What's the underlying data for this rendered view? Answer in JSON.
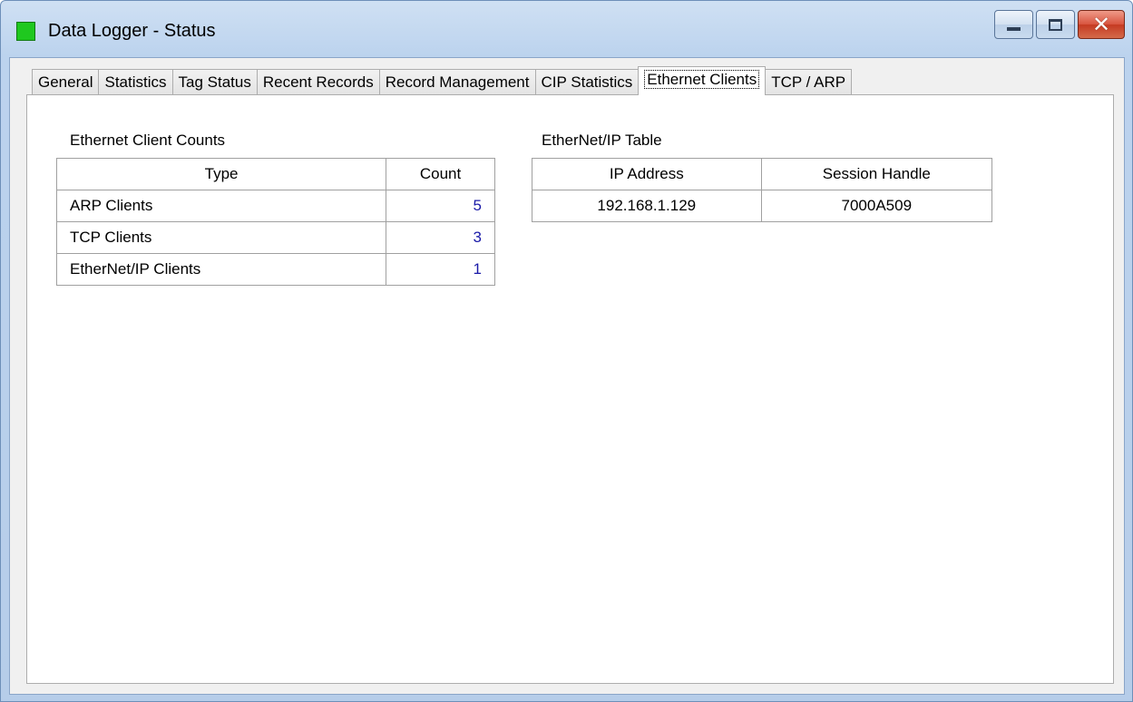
{
  "window": {
    "title": "Data Logger - Status",
    "buttons": {
      "minimize": "minimize",
      "maximize": "maximize",
      "close": "close"
    }
  },
  "tabs": [
    {
      "label": "General"
    },
    {
      "label": "Statistics"
    },
    {
      "label": "Tag Status"
    },
    {
      "label": "Recent Records"
    },
    {
      "label": "Record Management"
    },
    {
      "label": "CIP Statistics"
    },
    {
      "label": "Ethernet Clients",
      "active": true
    },
    {
      "label": "TCP / ARP"
    }
  ],
  "client_counts": {
    "title": "Ethernet Client Counts",
    "headers": {
      "type": "Type",
      "count": "Count"
    },
    "rows": [
      {
        "type": "ARP Clients",
        "count": "5"
      },
      {
        "type": "TCP Clients",
        "count": "3"
      },
      {
        "type": "EtherNet/IP Clients",
        "count": "1"
      }
    ]
  },
  "enip_table": {
    "title": "EtherNet/IP Table",
    "headers": {
      "ip": "IP Address",
      "session": "Session Handle"
    },
    "rows": [
      {
        "ip": "192.168.1.129",
        "session": "7000A509"
      }
    ]
  },
  "colors": {
    "status_icon": "#1fc81f",
    "count_text": "#1a1aa8",
    "titlebar": "#bcd3ee",
    "close_button": "#c53a22"
  }
}
